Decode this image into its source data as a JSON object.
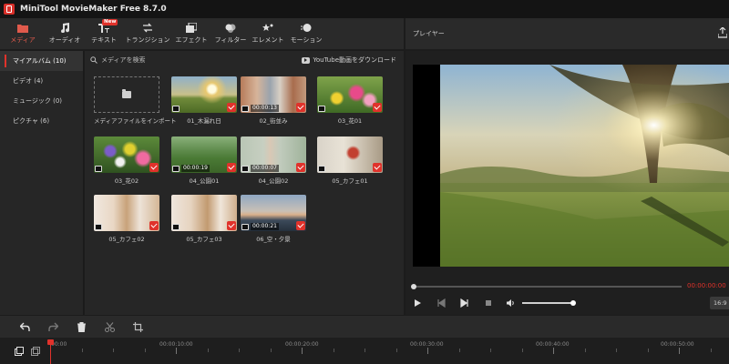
{
  "app": {
    "title": "MiniTool MovieMaker Free 8.7.0"
  },
  "toolbar": {
    "items": [
      {
        "label": "メディア",
        "icon": "folder-icon"
      },
      {
        "label": "オーディオ",
        "icon": "music-icon"
      },
      {
        "label": "テキスト",
        "icon": "text-icon",
        "badge": "New"
      },
      {
        "label": "トランジション",
        "icon": "transition-icon"
      },
      {
        "label": "エフェクト",
        "icon": "effect-icon"
      },
      {
        "label": "フィルター",
        "icon": "filter-icon"
      },
      {
        "label": "エレメント",
        "icon": "element-icon"
      },
      {
        "label": "モーション",
        "icon": "motion-icon"
      }
    ]
  },
  "sidebar": {
    "items": [
      {
        "label": "マイアルバム (10)"
      },
      {
        "label": "ビデオ (4)"
      },
      {
        "label": "ミュージック (0)"
      },
      {
        "label": "ピクチャ (6)"
      }
    ]
  },
  "media": {
    "search_placeholder": "メディアを検索",
    "youtube_label": "YouTube動画をダウンロード",
    "import_label": "メディアファイルをインポート",
    "items": [
      {
        "name": "01_木漏れ日",
        "type": "image",
        "duration": ""
      },
      {
        "name": "02_街並み",
        "type": "video",
        "duration": "00:00:13"
      },
      {
        "name": "03_花01",
        "type": "image",
        "duration": ""
      },
      {
        "name": "03_花02",
        "type": "image",
        "duration": ""
      },
      {
        "name": "04_公園01",
        "type": "video",
        "duration": "00:00:19"
      },
      {
        "name": "04_公園02",
        "type": "video",
        "duration": "00:00:07"
      },
      {
        "name": "05_カフェ01",
        "type": "image",
        "duration": ""
      },
      {
        "name": "05_カフェ02",
        "type": "image",
        "duration": ""
      },
      {
        "name": "05_カフェ03",
        "type": "image",
        "duration": ""
      },
      {
        "name": "06_空・夕景",
        "type": "video",
        "duration": "00:00:21"
      }
    ]
  },
  "player": {
    "title": "プレイヤー",
    "timecode": "00:00:00:00",
    "ratio": "16:9"
  },
  "timeline": {
    "labels": [
      "00:00",
      "00:00:10:00",
      "00:00:20:00",
      "00:00:30:00",
      "00:00:40:00",
      "00:00:50:00"
    ]
  },
  "colors": {
    "accent": "#e0322b",
    "background": "#1c1c1c",
    "panel": "#262626"
  }
}
